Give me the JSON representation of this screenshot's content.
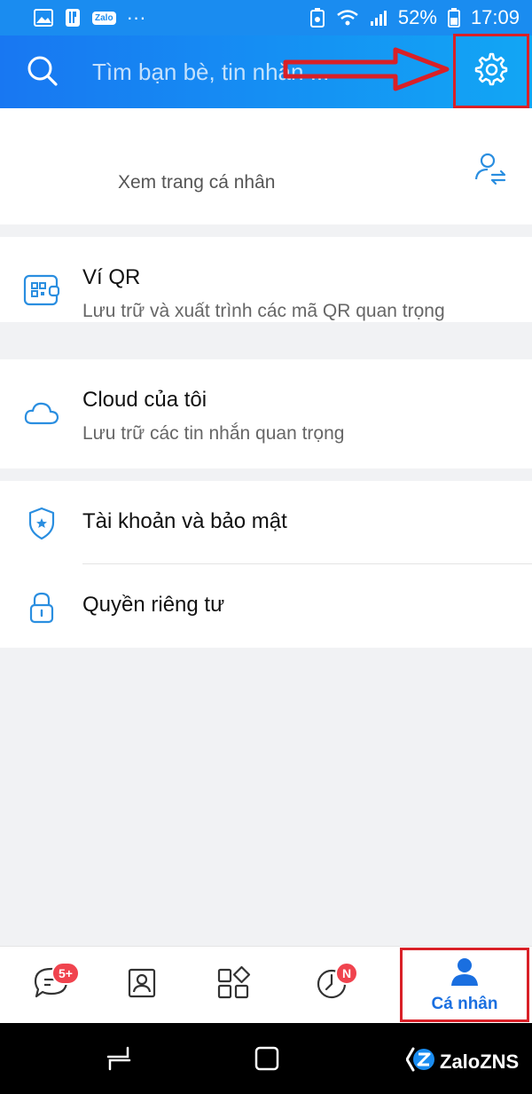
{
  "status_bar": {
    "battery_percent": "52%",
    "time": "17:09",
    "zalo_chip": "Zalo",
    "more": "···"
  },
  "header": {
    "search_placeholder": "Tìm bạn bè, tin nhắn ..."
  },
  "profile": {
    "subtitle": "Xem trang cá nhân"
  },
  "menu": [
    {
      "title": "Ví QR",
      "subtitle": "Lưu trữ và xuất trình các mã QR quan trọng"
    },
    {
      "title": "Cloud của tôi",
      "subtitle": "Lưu trữ các tin nhắn quan trọng"
    },
    {
      "title": "Tài khoản và bảo mật"
    },
    {
      "title": "Quyền riêng tư"
    }
  ],
  "bottom_nav": {
    "messages_badge": "5+",
    "timeline_badge": "N",
    "profile_label": "Cá nhân"
  },
  "watermark": {
    "text": "ZaloZNS"
  },
  "colors": {
    "accent": "#1a6fe0",
    "header_start": "#1877f2",
    "header_end": "#12a6f4",
    "badge": "#f0434e",
    "highlight": "#d92027"
  }
}
